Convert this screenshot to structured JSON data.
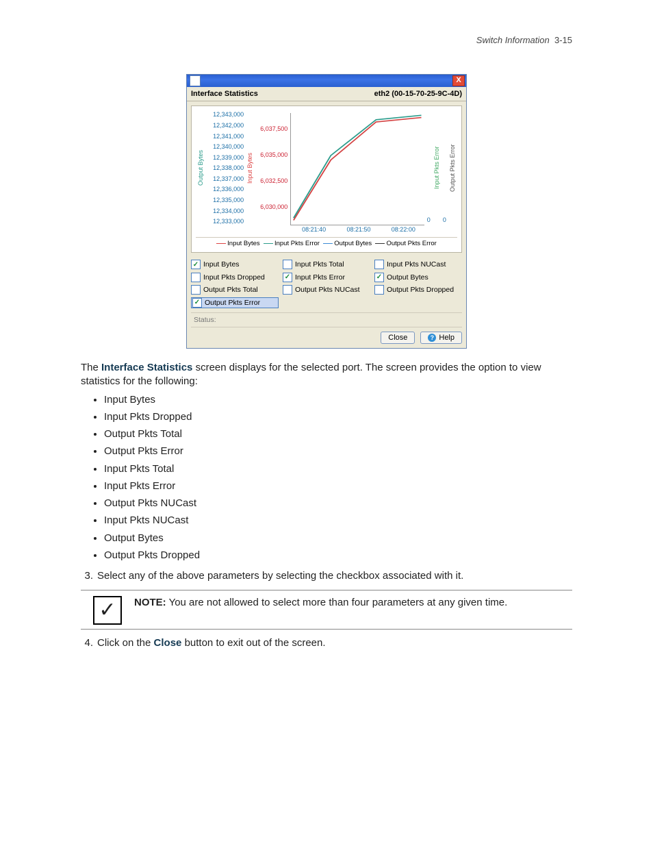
{
  "header": {
    "section": "Switch Information",
    "page": "3-15"
  },
  "dialog": {
    "title_left": "Interface Statistics",
    "title_right": "eth2 (00-15-70-25-9C-4D)",
    "close_x": "X",
    "axis_labels": {
      "output_bytes": "Output Bytes",
      "input_bytes": "Input Bytes",
      "input_pkts_error": "Input Pkts Error",
      "output_pkts_error": "Output Pkts Error"
    },
    "legend": {
      "inb": "Input Bytes",
      "ipe": "Input Pkts Error",
      "ob": "Output Bytes",
      "ope": "Output Pkts Error"
    },
    "zero": "0",
    "checkboxes": {
      "r0c0": "Input Bytes",
      "r0c1": "Input Pkts Total",
      "r0c2": "Input Pkts NUCast",
      "r1c0": "Input Pkts Dropped",
      "r1c1": "Input Pkts Error",
      "r1c2": "Output Bytes",
      "r2c0": "Output Pkts Total",
      "r2c1": "Output Pkts NUCast",
      "r2c2": "Output Pkts Dropped",
      "r3c0": "Output Pkts Error"
    },
    "status_label": "Status:",
    "buttons": {
      "close": "Close",
      "help": "Help"
    }
  },
  "chart_data": {
    "type": "line",
    "x": [
      "08:21:40",
      "08:21:50",
      "08:22:00"
    ],
    "y_left_output_bytes_ticks": [
      "12,343,000",
      "12,342,000",
      "12,341,000",
      "12,340,000",
      "12,339,000",
      "12,338,000",
      "12,337,000",
      "12,336,000",
      "12,335,000",
      "12,334,000",
      "12,333,000"
    ],
    "y_left_input_bytes_ticks": [
      "6,037,500",
      "6,035,000",
      "6,032,500",
      "6,030,000"
    ],
    "series": [
      {
        "name": "Input Bytes",
        "color": "#d44444",
        "values_approx": [
          6030000,
          6034800,
          6037400,
          6037600
        ]
      },
      {
        "name": "Output Bytes",
        "color": "#2c9c8c",
        "values_approx": [
          12333500,
          12338800,
          12342600,
          12343000
        ]
      },
      {
        "name": "Input Pkts Error",
        "color": "#4aa866",
        "values_approx": [
          0,
          0,
          0,
          0
        ]
      },
      {
        "name": "Output Pkts Error",
        "color": "#333333",
        "values_approx": [
          0,
          0,
          0,
          0
        ]
      }
    ]
  },
  "body": {
    "intro_pre": "The ",
    "intro_bold": "Interface Statistics",
    "intro_post": " screen displays for the selected port. The screen provides the option to view statistics for the following:",
    "bullets": [
      "Input Bytes",
      "Input Pkts Dropped",
      "Output Pkts Total",
      "Output Pkts Error",
      "Input Pkts Total",
      "Input Pkts Error",
      "Output Pkts NUCast",
      "Input Pkts NUCast",
      "Output Bytes",
      "Output Pkts Dropped"
    ],
    "step3_num": "3.",
    "step3": "Select any of the above parameters by selecting the checkbox associated with it.",
    "note_label": "NOTE:",
    "note_text": " You are not allowed to select more than four parameters at any given time.",
    "step4_num": "4.",
    "step4_pre": "Click on the ",
    "step4_bold": "Close",
    "step4_post": " button to exit out of the screen."
  }
}
